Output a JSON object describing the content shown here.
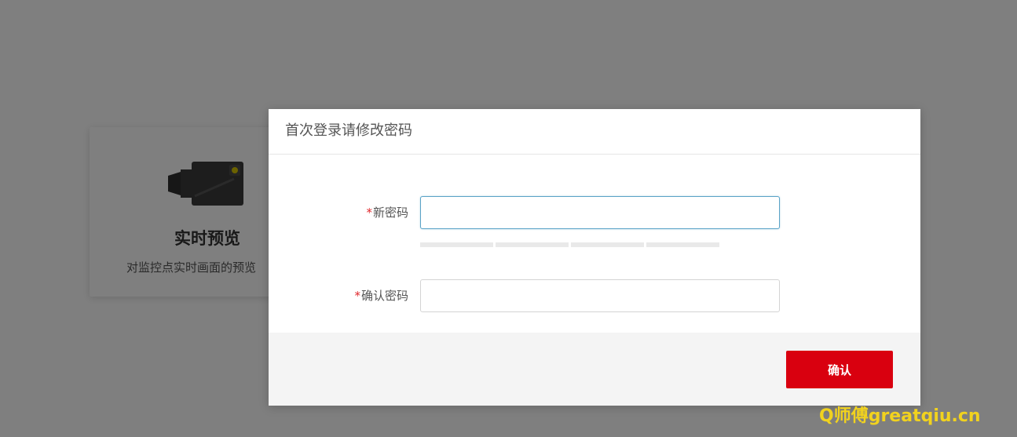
{
  "background": {
    "card": {
      "icon": "video-camera-icon",
      "title": "实时预览",
      "description": "对监控点实时画面的预览"
    }
  },
  "dialog": {
    "title": "首次登录请修改密码",
    "fields": [
      {
        "required_mark": "*",
        "label": "新密码",
        "value": "",
        "focused": true
      },
      {
        "required_mark": "*",
        "label": "确认密码",
        "value": "",
        "focused": false
      }
    ],
    "strength_segments": 4,
    "confirm_label": "确认"
  },
  "watermark": "Q师傅greatqiu.cn",
  "colors": {
    "primary_button": "#d9000f",
    "required_mark": "#e0262b",
    "focus_border": "#5aa3c7",
    "overlay": "rgba(0,0,0,0.5)",
    "watermark": "#f1d21e"
  }
}
